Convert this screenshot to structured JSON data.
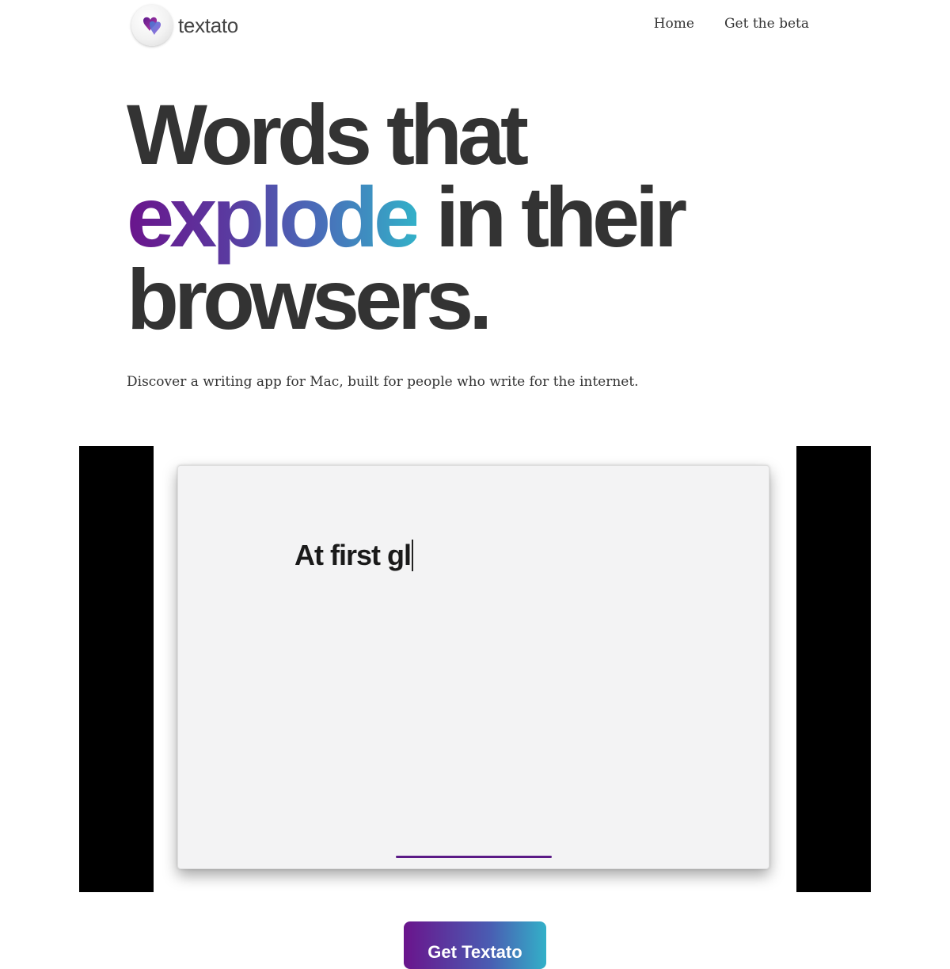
{
  "brand": {
    "name": "textato",
    "logo_icon": "heart-logo-icon",
    "accent_gradient": [
      "#6a148c",
      "#4a6ab8",
      "#33b0c8"
    ]
  },
  "nav": {
    "items": [
      {
        "label": "Home"
      },
      {
        "label": "Get the beta"
      }
    ]
  },
  "hero": {
    "title_line1": "Words that",
    "title_accent": "explode",
    "title_line2_rest": " in their",
    "title_line3": "browsers.",
    "subtitle": "Discover a writing app for Mac, built for people who write for the internet."
  },
  "demo_video": {
    "editor_text": "At first gl"
  },
  "cta": {
    "label": "Get Textato"
  }
}
